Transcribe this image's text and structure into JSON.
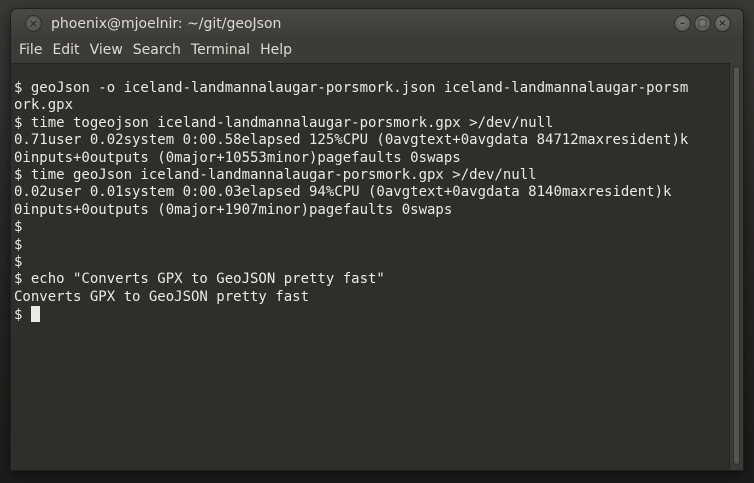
{
  "window": {
    "title": "phoenix@mjoelnir: ~/git/geoJson",
    "close_glyph": "×",
    "minimize_glyph": "–",
    "maximize_glyph": "□",
    "close2_glyph": "×"
  },
  "menu": {
    "items": [
      {
        "label": "File"
      },
      {
        "label": "Edit"
      },
      {
        "label": "View"
      },
      {
        "label": "Search"
      },
      {
        "label": "Terminal"
      },
      {
        "label": "Help"
      }
    ]
  },
  "terminal": {
    "lines": [
      "",
      "$ geoJson -o iceland-landmannalaugar-porsmork.json iceland-landmannalaugar-porsm",
      "ork.gpx",
      "$ time togeojson iceland-landmannalaugar-porsmork.gpx >/dev/null",
      "0.71user 0.02system 0:00.58elapsed 125%CPU (0avgtext+0avgdata 84712maxresident)k",
      "0inputs+0outputs (0major+10553minor)pagefaults 0swaps",
      "$ time geoJson iceland-landmannalaugar-porsmork.gpx >/dev/null",
      "0.02user 0.01system 0:00.03elapsed 94%CPU (0avgtext+0avgdata 8140maxresident)k",
      "0inputs+0outputs (0major+1907minor)pagefaults 0swaps",
      "$",
      "$",
      "$",
      "$ echo \"Converts GPX to GeoJSON pretty fast\"",
      "Converts GPX to GeoJSON pretty fast"
    ],
    "prompt": "$ "
  }
}
